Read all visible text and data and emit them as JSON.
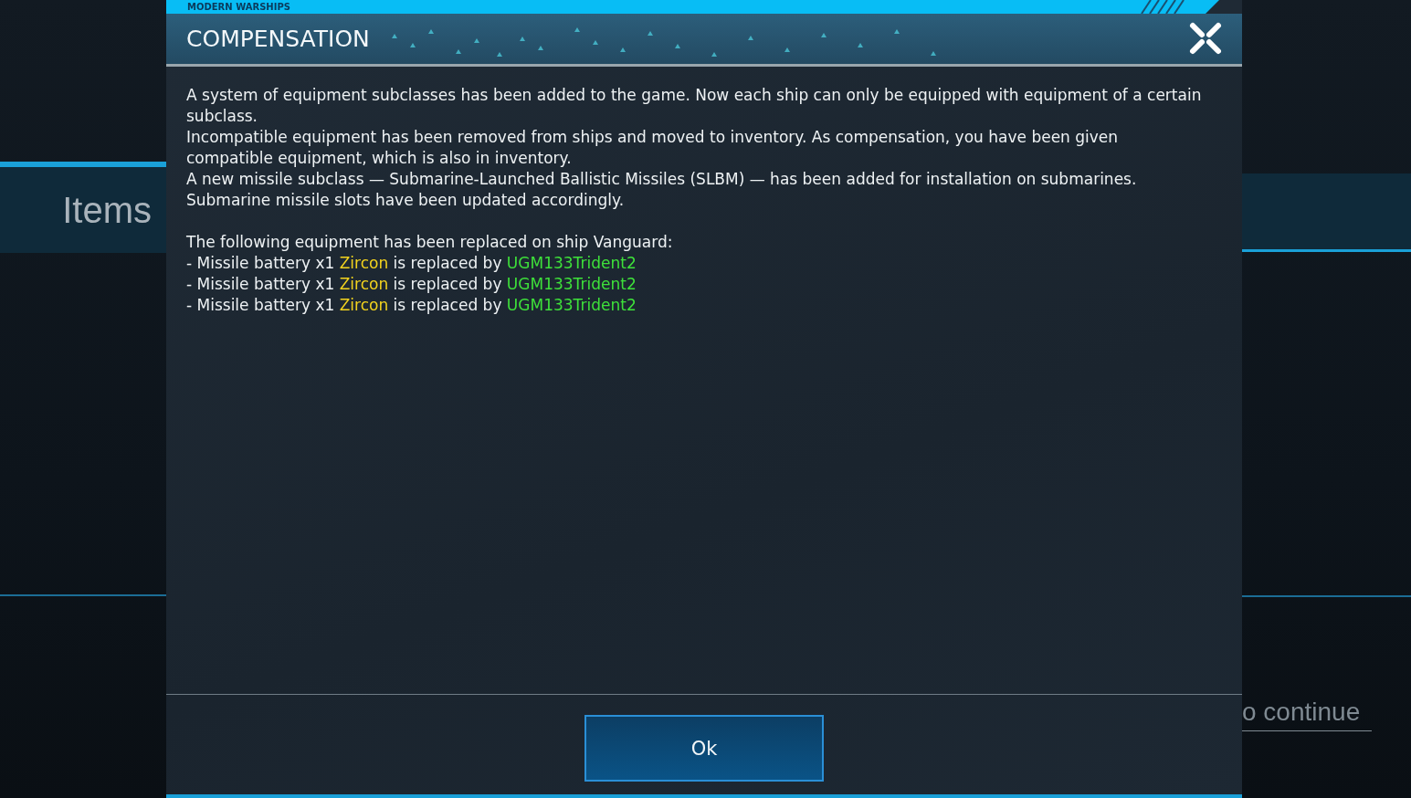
{
  "background": {
    "left_banner": "Items",
    "right_hint": "o continue"
  },
  "dialog": {
    "brand": "MODERN WARSHIPS",
    "title": "COMPENSATION",
    "paragraphs": [
      "A system of equipment subclasses has been added to the game. Now each ship can only be equipped with equipment of a certain subclass.",
      "Incompatible equipment has been removed from ships and moved to inventory. As compensation, you have been given compatible equipment, which is also in inventory.",
      "A new missile subclass — Submarine-Launched Ballistic Missiles (SLBM) — has been added for installation on submarines.",
      "Submarine missile slots have been updated accordingly."
    ],
    "replacement_intro": "The following equipment has been replaced on ship Vanguard:",
    "replacements": [
      {
        "item": "- Missile battery x1",
        "old": "Zircon",
        "middle": "is replaced by",
        "new": "UGM133Trident2"
      },
      {
        "item": "- Missile battery x1",
        "old": "Zircon",
        "middle": "is replaced by",
        "new": "UGM133Trident2"
      },
      {
        "item": "- Missile battery x1",
        "old": "Zircon",
        "middle": "is replaced by",
        "new": "UGM133Trident2"
      }
    ],
    "ok_button": "Ok"
  }
}
